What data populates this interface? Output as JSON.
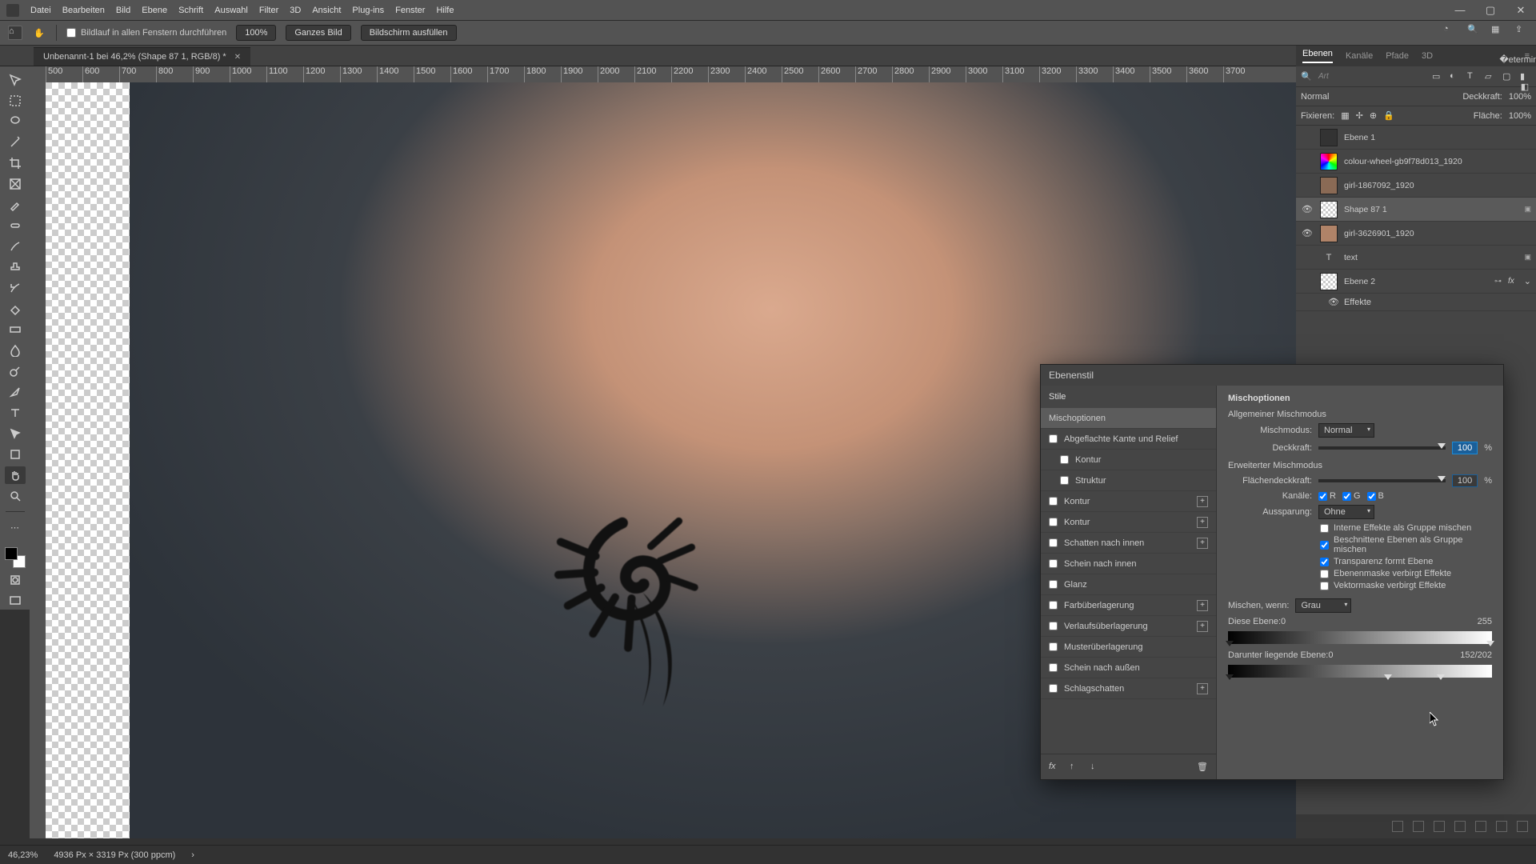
{
  "menu": {
    "items": [
      "Datei",
      "Bearbeiten",
      "Bild",
      "Ebene",
      "Schrift",
      "Auswahl",
      "Filter",
      "3D",
      "Ansicht",
      "Plug-ins",
      "Fenster",
      "Hilfe"
    ]
  },
  "options": {
    "scroll_all": "Bildlauf in allen Fenstern durchführen",
    "zoom": "100%",
    "fit": "Ganzes Bild",
    "fill": "Bildschirm ausfüllen"
  },
  "doc_tab": {
    "title": "Unbenannt-1 bei 46,2% (Shape 87 1, RGB/8) *"
  },
  "ruler": {
    "values": [
      "500",
      "600",
      "700",
      "800",
      "900",
      "1000",
      "1100",
      "1200",
      "1300",
      "1400",
      "1500",
      "1600",
      "1700",
      "1800",
      "1900",
      "2000",
      "2100",
      "2200",
      "2300",
      "2400",
      "2500",
      "2600",
      "2700",
      "2800",
      "2900",
      "3000",
      "3100",
      "3200",
      "3300",
      "3400",
      "3500",
      "3600",
      "3700"
    ]
  },
  "status": {
    "zoom": "46,23%",
    "dims": "4936 Px × 3319 Px (300 ppcm)"
  },
  "panels": {
    "tabs": [
      "Ebenen",
      "Kanäle",
      "Pfade",
      "3D"
    ],
    "filter_placeholder": "Art",
    "blend_mode": "Normal",
    "opacity_label": "Deckkraft:",
    "opacity_value": "100%",
    "lock_label": "Fixieren:",
    "fill_label": "Fläche:",
    "fill_value": "100%"
  },
  "layers": [
    {
      "name": "Ebene 1",
      "visible": false,
      "selected": false
    },
    {
      "name": "colour-wheel-gb9f78d013_1920",
      "visible": false,
      "selected": false
    },
    {
      "name": "girl-1867092_1920",
      "visible": false,
      "selected": false
    },
    {
      "name": "Shape 87 1",
      "visible": true,
      "selected": true,
      "smart": true
    },
    {
      "name": "girl-3626901_1920",
      "visible": true,
      "selected": false
    },
    {
      "name": "text",
      "visible": false,
      "selected": false,
      "type": "T",
      "smart": true
    },
    {
      "name": "Ebene 2",
      "visible": false,
      "selected": false,
      "fx": true
    }
  ],
  "effects_label": "Effekte",
  "dialog": {
    "title": "Ebenenstil",
    "styles_header": "Stile",
    "items": [
      {
        "label": "Mischoptionen",
        "selected": true
      },
      {
        "label": "Abgeflachte Kante und Relief",
        "check": true
      },
      {
        "label": "Kontur",
        "check": true,
        "indent": true
      },
      {
        "label": "Struktur",
        "check": true,
        "indent": true
      },
      {
        "label": "Kontur",
        "check": true,
        "plus": true
      },
      {
        "label": "Kontur",
        "check": true,
        "plus": true
      },
      {
        "label": "Schatten nach innen",
        "check": true,
        "plus": true
      },
      {
        "label": "Schein nach innen",
        "check": true
      },
      {
        "label": "Glanz",
        "check": true
      },
      {
        "label": "Farbüberlagerung",
        "check": true,
        "plus": true
      },
      {
        "label": "Verlaufsüberlagerung",
        "check": true,
        "plus": true
      },
      {
        "label": "Musterüberlagerung",
        "check": true
      },
      {
        "label": "Schein nach außen",
        "check": true
      },
      {
        "label": "Schlagschatten",
        "check": true,
        "plus": true
      }
    ],
    "main": {
      "title": "Mischoptionen",
      "general_header": "Allgemeiner Mischmodus",
      "mode_label": "Mischmodus:",
      "mode_value": "Normal",
      "opacity_label": "Deckkraft:",
      "opacity_value": "100",
      "adv_header": "Erweiterter Mischmodus",
      "fill_label": "Flächendeckkraft:",
      "fill_value": "100",
      "channels_label": "Kanäle:",
      "ch_r": "R",
      "ch_g": "G",
      "ch_b": "B",
      "knockout_label": "Aussparung:",
      "knockout_value": "Ohne",
      "cb1": "Interne Effekte als Gruppe mischen",
      "cb2": "Beschnittene Ebenen als Gruppe mischen",
      "cb3": "Transparenz formt Ebene",
      "cb4": "Ebenenmaske verbirgt Effekte",
      "cb5": "Vektormaske verbirgt Effekte",
      "blendif_label": "Mischen, wenn:",
      "blendif_value": "Grau",
      "this_layer": "Diese Ebene:",
      "this_low": "0",
      "this_high": "255",
      "under_layer": "Darunter liegende Ebene:",
      "under_low": "0",
      "under_mid": "152",
      "under_sep": "/",
      "under_high": "202",
      "percent": "%"
    }
  }
}
